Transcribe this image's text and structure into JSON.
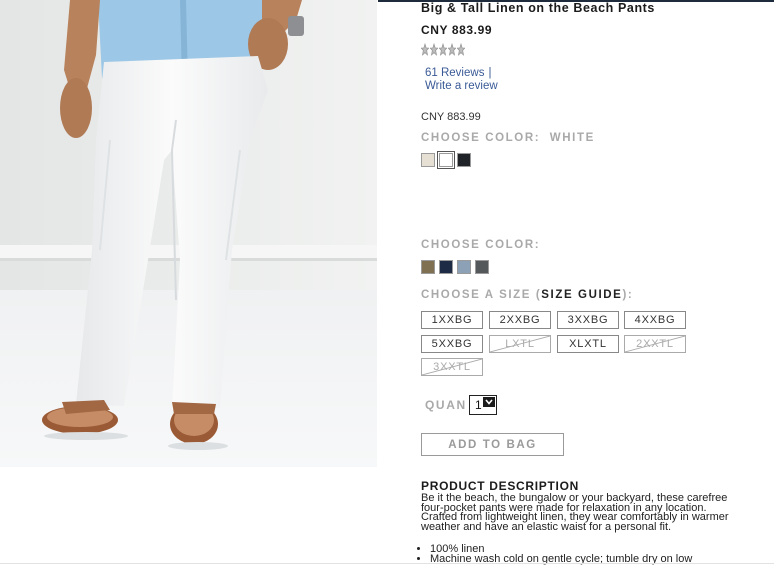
{
  "product": {
    "title": "Big & Tall Linen on the Beach Pants",
    "price": "CNY 883.99",
    "rating": {
      "stars": 5,
      "filled": 0
    },
    "reviews_link": "61 Reviews",
    "reviews_separator": "|",
    "write_review_link": "Write a review",
    "price_secondary": "CNY 883.99"
  },
  "color_section_1": {
    "label": "CHOOSE COLOR:",
    "selected": "WHITE",
    "swatches": [
      {
        "name": "sand",
        "color": "#e6e0d4"
      },
      {
        "name": "white",
        "color": "#ffffff"
      },
      {
        "name": "black",
        "color": "#1f2226"
      }
    ]
  },
  "color_section_2": {
    "label": "CHOOSE COLOR:",
    "swatches": [
      {
        "name": "olive",
        "color": "#7e7050"
      },
      {
        "name": "navy",
        "color": "#1e2b45"
      },
      {
        "name": "slate blue",
        "color": "#8ca1b6"
      },
      {
        "name": "charcoal",
        "color": "#55585b"
      }
    ]
  },
  "size_section": {
    "label": "CHOOSE A SIZE",
    "guide_label": "SIZE GUIDE",
    "sizes": [
      {
        "label": "1XXBG",
        "available": true
      },
      {
        "label": "2XXBG",
        "available": true
      },
      {
        "label": "3XXBG",
        "available": true
      },
      {
        "label": "4XXBG",
        "available": true
      },
      {
        "label": "5XXBG",
        "available": true
      },
      {
        "label": "LXTL",
        "available": false
      },
      {
        "label": "XLXTL",
        "available": true
      },
      {
        "label": "2XXTL",
        "available": false
      },
      {
        "label": "3XXTL",
        "available": false
      }
    ]
  },
  "quantity": {
    "label": "QUAN",
    "value": "1"
  },
  "add_to_bag": "ADD TO BAG",
  "description": {
    "title": "PRODUCT DESCRIPTION",
    "body": "Be it the beach, the bungalow or your backyard, these carefree four-pocket pants were made for relaxation in any location. Crafted from lightweight linen, they wear comfortably in warmer weather and have an elastic waist for a personal fit.",
    "bullets": [
      "100% linen",
      "Machine wash cold on gentle cycle; tumble dry on low"
    ]
  },
  "colors": {
    "accent_link": "#3a5a96",
    "muted_label": "#a9a9a9",
    "top_bar": "#1e2b3c"
  }
}
